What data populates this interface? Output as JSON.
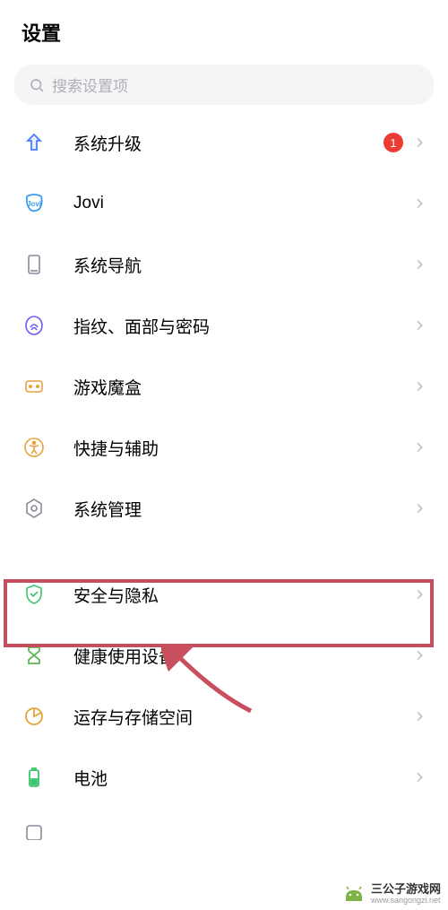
{
  "header": {
    "title": "设置"
  },
  "search": {
    "placeholder": "搜索设置项"
  },
  "badge1": "1",
  "items": [
    {
      "key": "system-upgrade",
      "label": "系统升级",
      "badge": true
    },
    {
      "key": "jovi",
      "label": "Jovi"
    },
    {
      "key": "system-navigation",
      "label": "系统导航"
    },
    {
      "key": "fingerprint-face-password",
      "label": "指纹、面部与密码"
    },
    {
      "key": "game-box",
      "label": "游戏魔盒"
    },
    {
      "key": "shortcut-accessibility",
      "label": "快捷与辅助"
    },
    {
      "key": "system-management",
      "label": "系统管理"
    },
    {
      "key": "security-privacy",
      "label": "安全与隐私"
    },
    {
      "key": "health-device",
      "label": "健康使用设备"
    },
    {
      "key": "ram-storage",
      "label": "运存与存储空间"
    },
    {
      "key": "battery",
      "label": "电池"
    }
  ],
  "watermark": {
    "title": "三公子游戏网",
    "url": "www.sangongzi.net"
  }
}
